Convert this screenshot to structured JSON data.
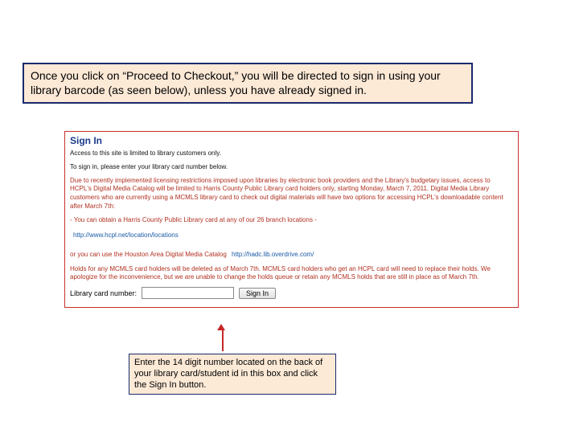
{
  "instruction": "Once you click on “Proceed to Checkout,” you will be directed to sign in using your library barcode (as seen below), unless you have already signed in.",
  "panel": {
    "title": "Sign In",
    "line1": "Access to this site is limited to library customers only.",
    "line2": "To sign in, please enter your library card number below.",
    "notice": "Due to recently implemented licensing restrictions imposed upon libraries by electronic book providers and the Library's budgetary issues, access to HCPL's Digital Media Catalog will be limited to Harris County Public Library card holders only, starting Monday, March 7, 2011. Digital Media Library customers who are currently using a MCMLS library card to check out digital materials will have two options for accessing HCPL's downloadable content after March 7th:",
    "opt1": "- You can obtain a Harris County Public Library card at any of our 26 branch locations -",
    "link1": "http://www.hcpl.net/location/locations",
    "opt2": "or you can use the Houston Area Digital Media Catalog",
    "link2": "http://hadc.lib.overdrive.com/",
    "notice2": "Holds for any MCMLS card holders will be deleted as of March 7th. MCMLS card holders who get an HCPL card will need to replace their holds. We apologize for the inconvenience, but we are unable to change the holds queue or retain any MCMLS holds that are still in place as of March 7th.",
    "field_label": "Library card number:",
    "button_label": "Sign In"
  },
  "tip": "Enter the 14 digit number located on the back of your library card/student id in this box and click the Sign In button."
}
